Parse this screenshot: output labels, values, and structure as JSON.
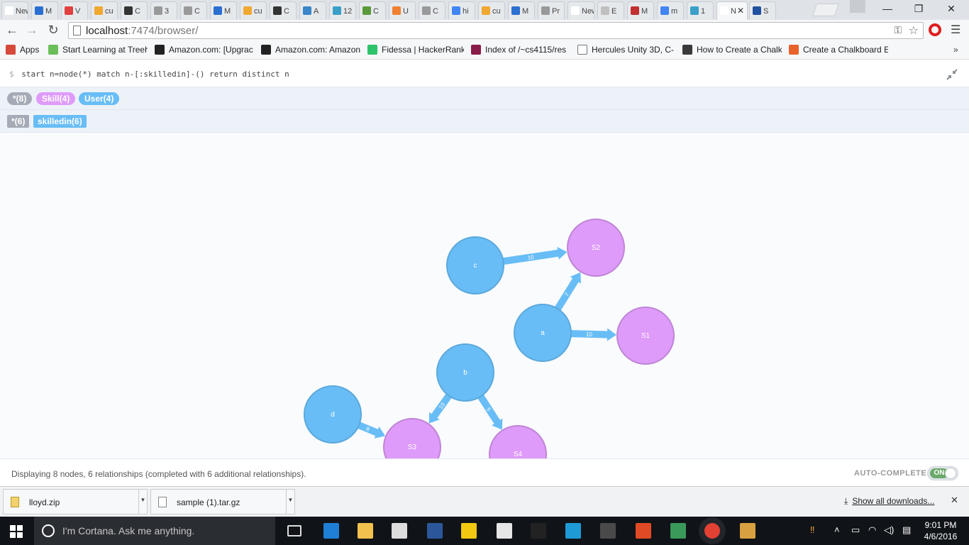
{
  "browser": {
    "tabs": [
      "New",
      "M",
      "V",
      "cu",
      "C",
      "3",
      "C",
      "M",
      "cu",
      "C",
      "A",
      "12",
      "C",
      "U",
      "C",
      "hi",
      "cu",
      "M",
      "Pr",
      "New",
      "E",
      "M",
      "m",
      "1",
      "N",
      "S"
    ],
    "active_tab": "N",
    "url_host": "localhost",
    "url_rest": ":7474/browser/",
    "window_controls": {
      "minimize": "—",
      "restore": "❐",
      "close": "✕"
    }
  },
  "bookmarks": [
    {
      "label": "Apps",
      "color": "#d64a3a"
    },
    {
      "label": "Start Learning at Treeh",
      "color": "#6bbf59"
    },
    {
      "label": "Amazon.com: [Upgrac",
      "color": "#222222"
    },
    {
      "label": "Amazon.com: Amazon",
      "color": "#222222"
    },
    {
      "label": "Fidessa | HackerRank",
      "color": "#2fc36a"
    },
    {
      "label": "Index of /~cs4115/res",
      "color": "#8a1c4a"
    },
    {
      "label": "Hercules Unity 3D, C-",
      "color": "#ffffff"
    },
    {
      "label": "How to Create a Chalk",
      "color": "#3a3a3a"
    },
    {
      "label": "Create a Chalkboard E",
      "color": "#e8622c"
    }
  ],
  "neo4j": {
    "prompt": "$",
    "query": "start n=node(*) match n-[:skilledin]-() return distinct n",
    "node_labels": [
      {
        "label": "*(8)",
        "color": "#a5abb6"
      },
      {
        "label": "Skill(4)",
        "color": "#de9bf9"
      },
      {
        "label": "User(4)",
        "color": "#68bdf6"
      }
    ],
    "rel_types": [
      {
        "label": "*(6)",
        "color": "#a5abb6"
      },
      {
        "label": "skilledin(6)",
        "color": "#68bdf6"
      }
    ],
    "status": "Displaying 8 nodes, 6 relationships (completed with 6 additional relationships).",
    "autocomplete_label": "AUTO-COMPLETE",
    "autocomplete_state": "ON",
    "colors": {
      "user": "#68bdf6",
      "user_stroke": "#5ca8db",
      "skill": "#de9bf9",
      "skill_stroke": "#bf85d6",
      "rel": "#68bdf6"
    },
    "graph": {
      "nodes": [
        {
          "id": "c",
          "label": "c",
          "type": "user"
        },
        {
          "id": "S2",
          "label": "S2",
          "type": "skill"
        },
        {
          "id": "a",
          "label": "a",
          "type": "user"
        },
        {
          "id": "S1",
          "label": "S1",
          "type": "skill"
        },
        {
          "id": "b",
          "label": "b",
          "type": "user"
        },
        {
          "id": "d",
          "label": "d",
          "type": "user"
        },
        {
          "id": "S3",
          "label": "S3",
          "type": "skill"
        },
        {
          "id": "S4",
          "label": "S4",
          "type": "skill"
        }
      ],
      "edges": [
        {
          "from": "c",
          "to": "S2",
          "label": "10"
        },
        {
          "from": "a",
          "to": "S2",
          "label": "7"
        },
        {
          "from": "a",
          "to": "S1",
          "label": "10"
        },
        {
          "from": "b",
          "to": "S3",
          "label": "10"
        },
        {
          "from": "b",
          "to": "S4",
          "label": "5"
        },
        {
          "from": "d",
          "to": "S3",
          "label": "8"
        }
      ]
    }
  },
  "downloads": {
    "items": [
      {
        "name": "lloyd.zip",
        "icon": "zip-file-icon"
      },
      {
        "name": "sample (1).tar.gz",
        "icon": "file-icon"
      }
    ],
    "show_all": "Show all downloads...",
    "close": "✕"
  },
  "taskbar": {
    "cortana_placeholder": "I'm Cortana. Ask me anything.",
    "time": "9:01 PM",
    "date": "4/6/2016",
    "apps": [
      "task-view-icon",
      "edge-icon",
      "file-explorer-icon",
      "store-icon",
      "word-icon",
      "powerbi-icon",
      "unity-icon",
      "cmd-icon",
      "devtool-icon",
      "sublime-icon",
      "office-icon",
      "maps-icon",
      "chrome-icon",
      "paint-icon"
    ]
  }
}
